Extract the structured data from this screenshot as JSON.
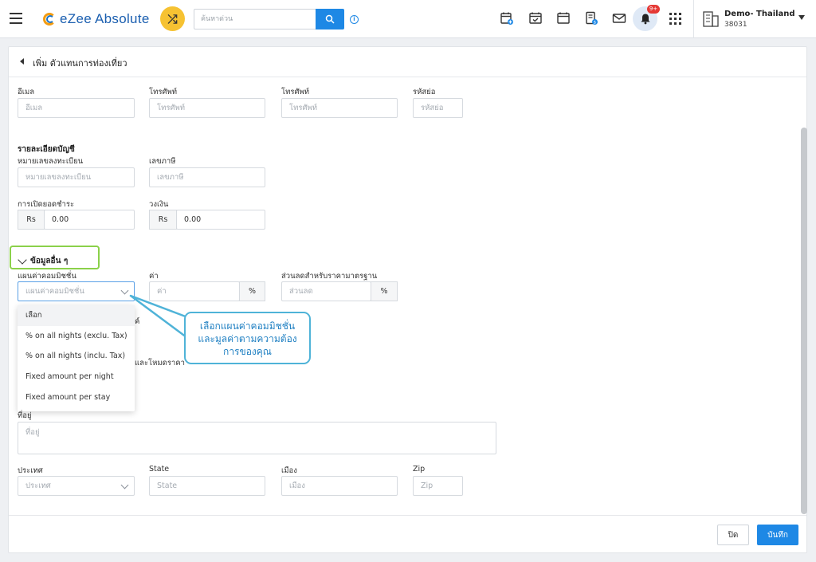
{
  "header": {
    "app_name": "eZee Absolute",
    "search_placeholder": "ค้นหาด่วน",
    "notification_badge": "9+",
    "hotel_name": "Demo- Thailand",
    "hotel_code": "38031",
    "icons": [
      "menu-icon",
      "shuffle-icon",
      "search-icon",
      "info-icon",
      "calendar-add-icon",
      "calendar-check-icon",
      "calendar-icon",
      "invoice-icon",
      "mail-icon",
      "bell-icon",
      "apps-icon",
      "building-icon",
      "caret-down-icon"
    ]
  },
  "page": {
    "title": "เพิ่ม ตัวแทนการท่องเที่ยว"
  },
  "contact": {
    "email_label": "อีเมล",
    "email_placeholder": "อีเมล",
    "phone1_label": "โทรศัพท์",
    "phone1_placeholder": "โทรศัพท์",
    "phone2_label": "โทรศัพท์",
    "phone2_placeholder": "โทรศัพท์",
    "shortcode_label": "รหัสย่อ",
    "shortcode_placeholder": "รหัสย่อ"
  },
  "account": {
    "section_title": "รายละเอียดบัญชี",
    "reg_no_label": "หมายเลขลงทะเบียน",
    "reg_no_placeholder": "หมายเลขลงทะเบียน",
    "tax_id_label": "เลขภาษี",
    "tax_id_placeholder": "เลขภาษี",
    "opening_balance_label": "การเปิดยอดชำระ",
    "opening_balance_currency": "Rs",
    "opening_balance_value": "0.00",
    "credit_limit_label": "วงเงิน",
    "credit_limit_currency": "Rs",
    "credit_limit_value": "0.00"
  },
  "other_info": {
    "section_title": "ข้อมูลอื่น ๆ",
    "commission_plan_label": "แผนค่าคอมมิชชั่น",
    "commission_plan_placeholder": "แผนค่าคอมมิชชั่น",
    "value_label": "ค่า",
    "value_placeholder": "ค่า",
    "value_suffix": "%",
    "discount_label": "ส่วนลดสำหรับราคามาตรฐาน",
    "discount_placeholder": "ส่วนลด",
    "discount_suffix": "%",
    "hidden_label_1_tail": "ค์",
    "hidden_label_2_tail": "และโหมดราคา",
    "dropdown_options": [
      "เลือก",
      "% on all nights (exclu. Tax)",
      "% on all nights (inclu. Tax)",
      "Fixed amount per night",
      "Fixed amount per stay"
    ]
  },
  "address": {
    "address_label": "ที่อยู่",
    "address_placeholder": "ที่อยู่",
    "country_label": "ประเทศ",
    "country_placeholder": "ประเทศ",
    "state_label": "State",
    "state_placeholder": "State",
    "city_label": "เมือง",
    "city_placeholder": "เมือง",
    "zip_label": "Zip",
    "zip_placeholder": "Zip"
  },
  "callout": {
    "line1": "เลือกแผนค่าคอมมิชชั่น",
    "line2": "และมูลค่าตามความต้อง",
    "line3": "การของคุณ"
  },
  "footer": {
    "close_label": "ปิด",
    "save_label": "บันทึก"
  },
  "colors": {
    "primary": "#1e88e5",
    "accent_yellow": "#f6c232",
    "highlight_green": "#8bd14a",
    "callout_blue": "#4fb3d8",
    "badge_red": "#e53935"
  }
}
